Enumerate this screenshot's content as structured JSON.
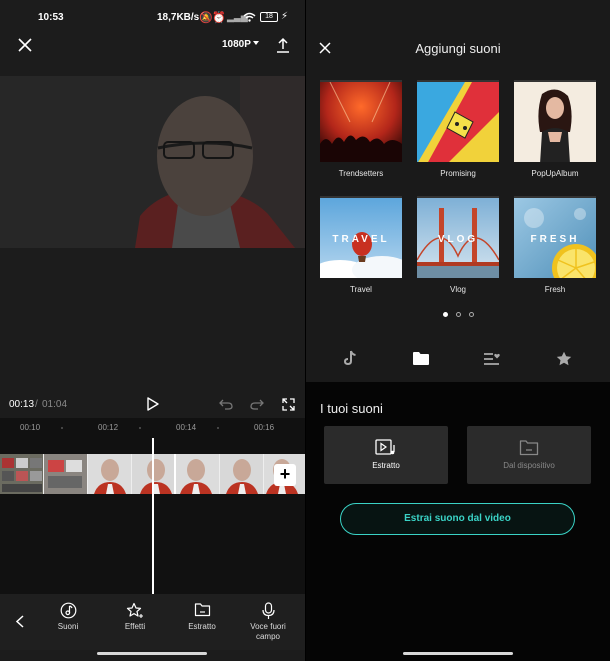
{
  "status_bar": {
    "time": "10:53",
    "speed": "18,7KB/s",
    "battery": "18"
  },
  "editor": {
    "resolution": "1080P",
    "time_current": "00:13",
    "time_separator": "/",
    "time_total": "01:04",
    "ticks": [
      "00:10",
      "00:12",
      "00:14",
      "00:16"
    ],
    "toolbar": [
      {
        "label": "Suoni",
        "icon": "music-note-icon"
      },
      {
        "label": "Effetti",
        "icon": "star-sparkle-icon"
      },
      {
        "label": "Estratto",
        "icon": "folder-icon"
      },
      {
        "label": "Voce fuori campo",
        "icon": "microphone-icon"
      }
    ]
  },
  "sounds": {
    "title": "Aggiungi suoni",
    "albums": [
      {
        "name": "Trendsetters"
      },
      {
        "name": "Promising"
      },
      {
        "name": "PopUpAlbum"
      },
      {
        "name": "Travel",
        "cover_text": "TRAVEL"
      },
      {
        "name": "Vlog",
        "cover_text": "VLOG"
      },
      {
        "name": "Fresh",
        "cover_text": "FRESH"
      }
    ],
    "page_indicator": {
      "pages": 3,
      "current": 1
    },
    "category_tabs": [
      "tiktok-icon",
      "folder-icon",
      "playlist-heart-icon",
      "star-icon"
    ],
    "active_tab": 1,
    "your_sounds_title": "I tuoi suoni",
    "source_buttons": [
      {
        "label": "Estratto",
        "icon": "video-music-icon",
        "enabled": true
      },
      {
        "label": "Dal dispositivo",
        "icon": "folder-icon",
        "enabled": false
      }
    ],
    "extract_button": "Estrai suono dal video"
  },
  "colors": {
    "accent": "#3ad3c6",
    "panel_bg": "#1c1c1c",
    "timeline_bg": "#111111"
  }
}
